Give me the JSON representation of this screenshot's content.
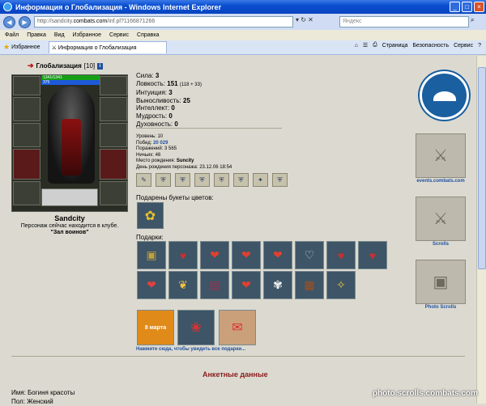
{
  "window": {
    "title": "Информация о Глобализация - Windows Internet Explorer",
    "url_prefix": "http://sandcity.",
    "url_domain": "combats.com",
    "url_path": "/inf.pl?1166871266",
    "search_placeholder": "Яндекс"
  },
  "menu": [
    "Файл",
    "Правка",
    "Вид",
    "Избранное",
    "Сервис",
    "Справка"
  ],
  "favorites_label": "Избранное",
  "tab_title": "Информация о Глобализация",
  "tools": [
    "Страница",
    "Безопасность",
    "Сервис"
  ],
  "character": {
    "name_heading": "Глобализация",
    "level": "[10]",
    "hp": "1341/1341",
    "mana": "375",
    "display_name": "Sandcity",
    "location_line": "Персонаж сейчас находится в клубе.",
    "location_room": "\"Зал воинов\""
  },
  "stats": [
    {
      "label": "Сила:",
      "value": "3",
      "extra": ""
    },
    {
      "label": "Ловкость:",
      "value": "151",
      "extra": "(118 + 33)"
    },
    {
      "label": "Интуиция:",
      "value": "3",
      "extra": ""
    },
    {
      "label": "Выносливость:",
      "value": "25",
      "extra": ""
    },
    {
      "label": "Интеллект:",
      "value": "0",
      "extra": ""
    },
    {
      "label": "Мудрость:",
      "value": "0",
      "extra": ""
    },
    {
      "label": "Духовность:",
      "value": "0",
      "extra": ""
    }
  ],
  "info": {
    "level": "Уровень: 10",
    "wins_label": "Побед:",
    "wins": "20 029",
    "losses": "Поражений: 3 565",
    "draws": "Ничьих: 46",
    "birthplace_label": "Место рождения:",
    "birthplace": "Suncity",
    "birthday": "День рождения персонажа: 23.12.06 18:54"
  },
  "flowers_label": "Подарены букеты цветов:",
  "gifts_label": "Подарки:",
  "more_gifts_link": "Нажмите сюда, чтобы увидеть все подарки...",
  "big_gift_text": "8 марта",
  "anketa_title": "Анкетные данные",
  "anketa_lines": [
    "Имя: Богиня красоты",
    "Пол: Женский"
  ],
  "right": {
    "events_label": "events.combats.com",
    "scrolls_label": "Scrolls",
    "photo_label": "Photo Scrolls"
  },
  "watermark": "photo.scrolls.combats.com"
}
